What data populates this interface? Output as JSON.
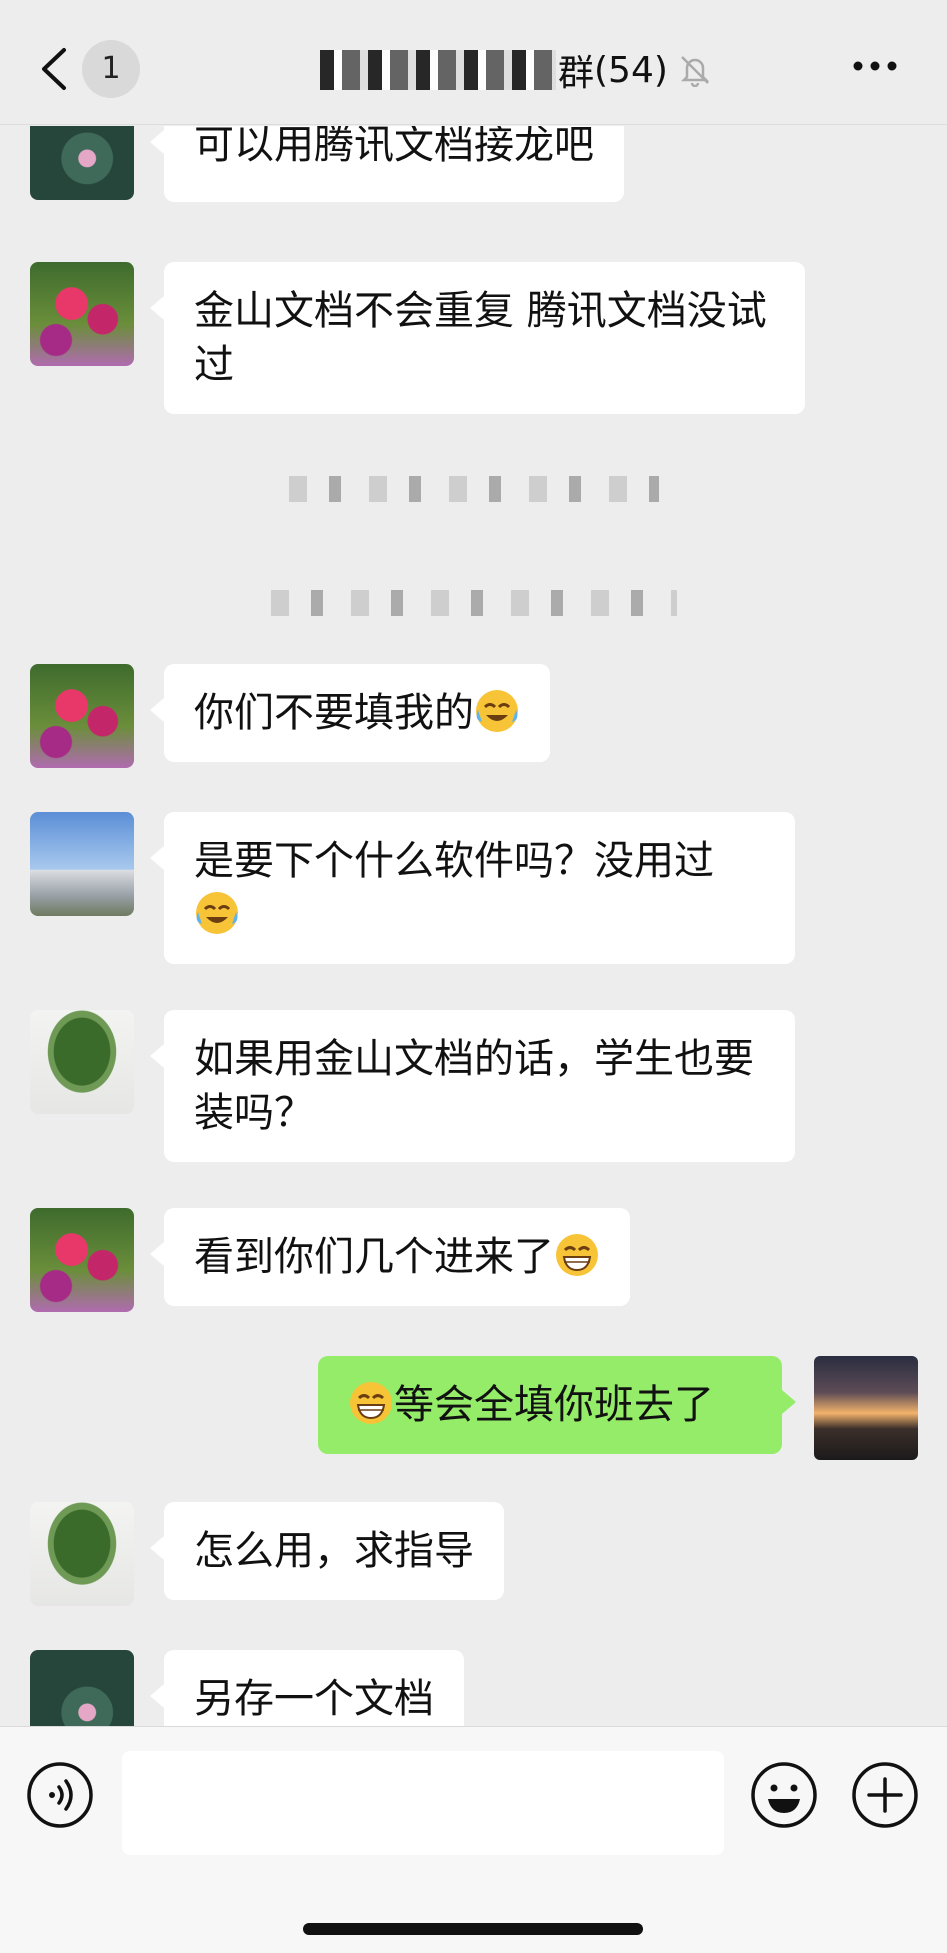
{
  "header": {
    "back_icon": "chevron-left-icon",
    "unread_count": "1",
    "group_name_suffix": "群",
    "member_count": "(54)",
    "mute_icon": "bell-slash-icon",
    "more_icon": "more-horizontal-icon"
  },
  "messages": [
    {
      "sender": "lotus-avatar",
      "text": "可以用腾讯文档接龙吧"
    },
    {
      "sender": "flower-avatar",
      "text": "金山文档不会重复 腾讯文档没试过"
    },
    {
      "sender": "flower-avatar",
      "text": "你们不要填我的",
      "emoji": "crying-laughing-emoji"
    },
    {
      "sender": "city-avatar",
      "text": "是要下个什么软件吗？没用过",
      "emoji": "crying-laughing-emoji"
    },
    {
      "sender": "tree-avatar",
      "text": "如果用金山文档的话，学生也要装吗？"
    },
    {
      "sender": "flower-avatar",
      "text": "看到你们几个进来了",
      "emoji": "grinning-emoji"
    },
    {
      "sender": "self",
      "text": "等会全填你班去了",
      "emoji": "grinning-emoji"
    },
    {
      "sender": "tree-avatar",
      "text": "怎么用，求指导"
    },
    {
      "sender": "lotus-avatar",
      "text": "另存一个文档"
    }
  ],
  "input": {
    "voice_icon": "voice-icon",
    "emoji_icon": "smiley-icon",
    "plus_icon": "plus-circle-icon"
  },
  "colors": {
    "background": "#ededed",
    "bubble_other": "#ffffff",
    "bubble_self": "#95ec69"
  }
}
